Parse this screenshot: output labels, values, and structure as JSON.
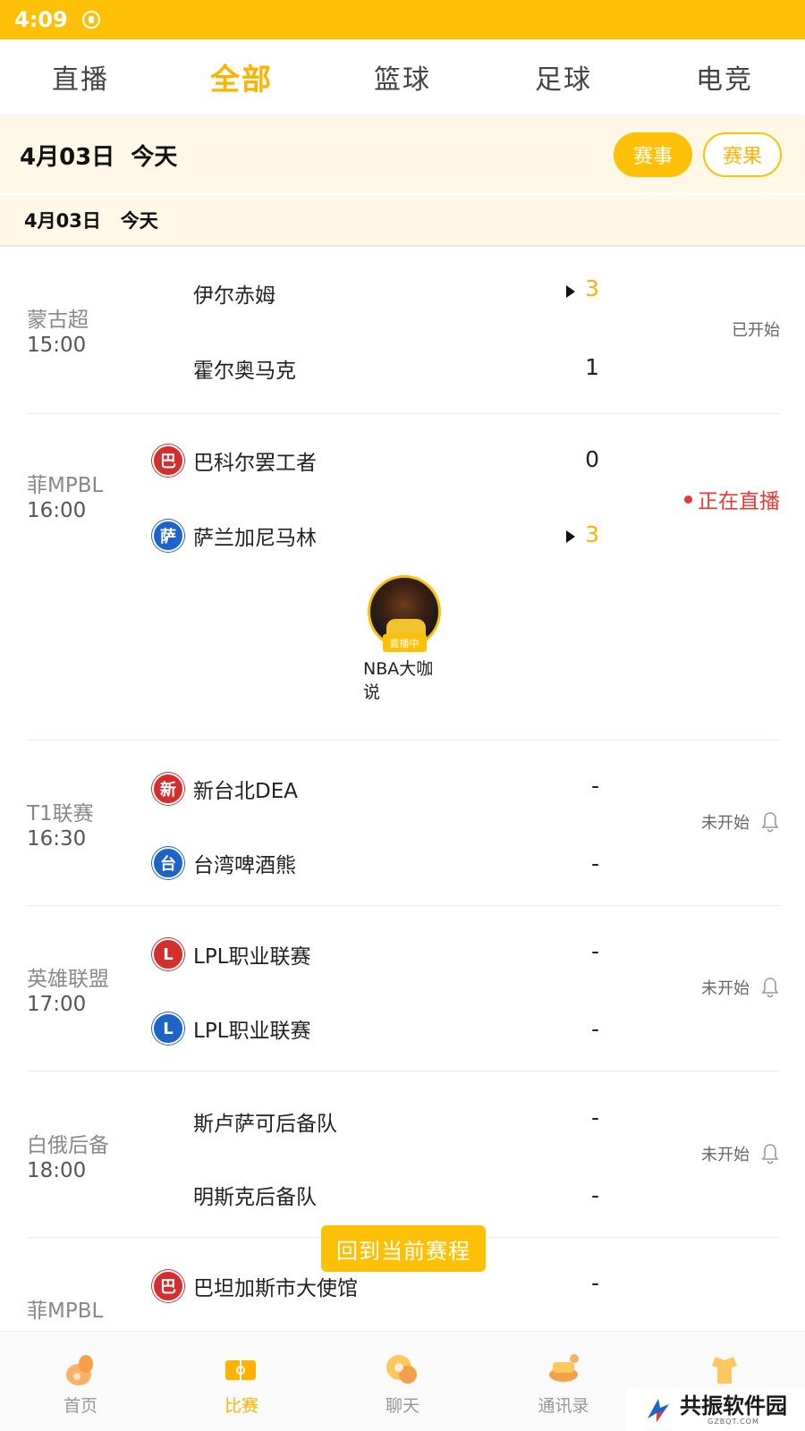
{
  "status_bar": {
    "time": "4:09"
  },
  "top_tabs": [
    {
      "label": "直播",
      "active": false
    },
    {
      "label": "全部",
      "active": true
    },
    {
      "label": "篮球",
      "active": false
    },
    {
      "label": "足球",
      "active": false
    },
    {
      "label": "电竞",
      "active": false
    }
  ],
  "date_header": {
    "title": "4月03日  今天",
    "events_button": "赛事",
    "results_button": "赛果"
  },
  "date_sub": "4月03日   今天",
  "matches": [
    {
      "league": "蒙古超",
      "time": "15:00",
      "home": {
        "name": "伊尔赤姆",
        "score": "3",
        "winner": true
      },
      "away": {
        "name": "霍尔奥马克",
        "score": "1",
        "winner": false
      },
      "status": "已开始"
    },
    {
      "league": "菲MPBL",
      "time": "16:00",
      "home": {
        "name": "巴科尔罢工者",
        "logo": "巴",
        "score": "0",
        "winner": false
      },
      "away": {
        "name": "萨兰加尼马林",
        "logo": "萨",
        "score": "3",
        "winner": true
      },
      "status": "正在直播",
      "streamer": {
        "tag": "直播中",
        "name": "NBA大咖说"
      }
    },
    {
      "league": "T1联赛",
      "time": "16:30",
      "home": {
        "name": "新台北DEA",
        "logo": "新",
        "score": "-"
      },
      "away": {
        "name": "台湾啤酒熊",
        "logo": "台",
        "score": "-"
      },
      "status": "未开始"
    },
    {
      "league": "英雄联盟",
      "time": "17:00",
      "home": {
        "name": "LPL职业联赛",
        "logo": "L",
        "score": "-"
      },
      "away": {
        "name": "LPL职业联赛",
        "logo": "L",
        "score": "-"
      },
      "status": "未开始"
    },
    {
      "league": "白俄后备",
      "time": "18:00",
      "home": {
        "name": "斯卢萨可后备队",
        "score": "-"
      },
      "away": {
        "name": "明斯克后备队",
        "score": "-"
      },
      "status": "未开始"
    },
    {
      "league": "菲MPBL",
      "home": {
        "name": "巴坦加斯市大使馆",
        "logo": "巴",
        "score": "-"
      }
    }
  ],
  "back_button": "回到当前赛程",
  "bottom_nav": [
    {
      "label": "首页",
      "icon": "home-icon",
      "active": false
    },
    {
      "label": "比赛",
      "icon": "match-icon",
      "active": true
    },
    {
      "label": "聊天",
      "icon": "chat-icon",
      "active": false
    },
    {
      "label": "通讯录",
      "icon": "contacts-icon",
      "active": false
    },
    {
      "label": "",
      "icon": "profile-icon",
      "active": false
    }
  ],
  "watermark": {
    "text": "共振软件园",
    "sub": "GZBQT.COM"
  },
  "colors": {
    "accent": "#FFC107",
    "live": "#E53935",
    "team_red": "#D32F2F",
    "team_blue": "#1E63C7"
  }
}
